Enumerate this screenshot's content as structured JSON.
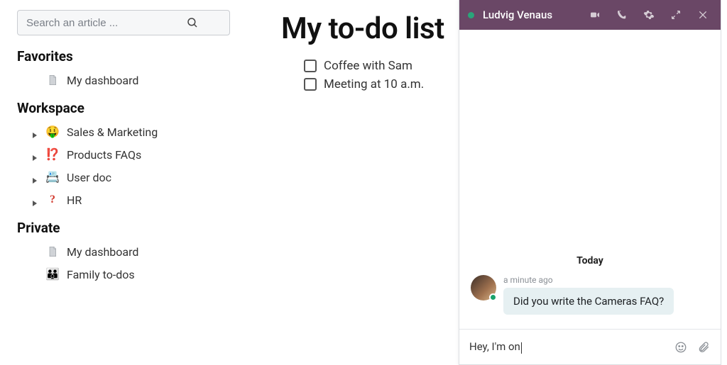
{
  "search": {
    "placeholder": "Search an article ..."
  },
  "sections": {
    "favorites": {
      "title": "Favorites",
      "items": [
        {
          "label": "My dashboard",
          "icon": "document-icon"
        }
      ]
    },
    "workspace": {
      "title": "Workspace",
      "items": [
        {
          "label": "Sales & Marketing",
          "icon": "emoji-money-face"
        },
        {
          "label": "Products FAQs",
          "icon": "emoji-double-exclaim"
        },
        {
          "label": "User doc",
          "icon": "emoji-card-index"
        },
        {
          "label": "HR",
          "icon": "emoji-red-qmark"
        }
      ]
    },
    "private": {
      "title": "Private",
      "items": [
        {
          "label": "My dashboard",
          "icon": "document-icon"
        },
        {
          "label": "Family to-dos",
          "icon": "emoji-family"
        }
      ]
    }
  },
  "doc": {
    "title": "My to-do list",
    "todos": [
      {
        "label": "Coffee with Sam",
        "checked": false
      },
      {
        "label": "Meeting at 10 a.m.",
        "checked": false
      }
    ]
  },
  "chat": {
    "name": "Ludvig Venaus",
    "accent": "#6a4766",
    "day_label": "Today",
    "messages": [
      {
        "time": "a minute ago",
        "text": "Did you write the Cameras FAQ?"
      }
    ],
    "composer_value": "Hey, I'm on"
  }
}
